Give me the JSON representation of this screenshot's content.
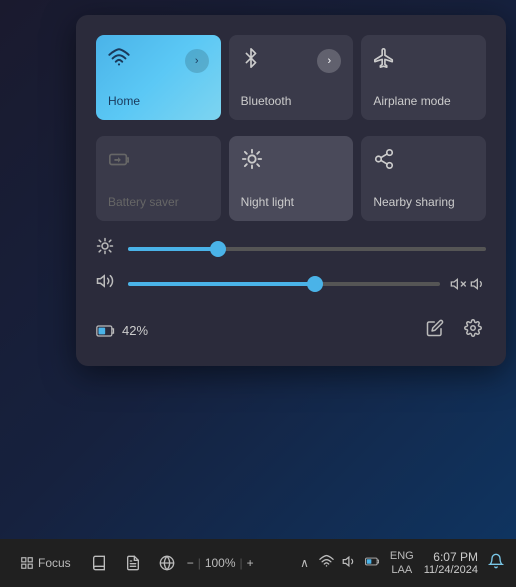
{
  "panel": {
    "tiles_row1": [
      {
        "id": "home",
        "label": "Home",
        "icon": "📶",
        "iconType": "wifi",
        "active": true,
        "hasChevron": true
      },
      {
        "id": "bluetooth",
        "label": "Bluetooth",
        "icon": "⚡",
        "iconType": "bluetooth",
        "active": false,
        "hasChevron": true
      },
      {
        "id": "airplane",
        "label": "Airplane mode",
        "icon": "✈",
        "iconType": "airplane",
        "active": false,
        "hasChevron": false
      }
    ],
    "tiles_row2": [
      {
        "id": "battery-saver",
        "label": "Battery saver",
        "icon": "🔋",
        "iconType": "battery",
        "active": false,
        "disabled": true,
        "hasChevron": false
      },
      {
        "id": "night-light",
        "label": "Night light",
        "icon": "☀",
        "iconType": "sun",
        "active": true,
        "hasChevron": false
      },
      {
        "id": "nearby-sharing",
        "label": "Nearby sharing",
        "icon": "⬆",
        "iconType": "share",
        "active": false,
        "hasChevron": false
      }
    ],
    "brightness": {
      "icon": "☀",
      "value": 25
    },
    "volume": {
      "icon": "🔊",
      "value": 60
    },
    "battery_percent": "42%",
    "battery_icon": "🔋"
  },
  "taskbar": {
    "chevron_label": "^",
    "lang_line1": "ENG",
    "lang_line2": "LAA",
    "time": "6:07 PM",
    "date": "11/24/2024",
    "focus_label": "Focus",
    "zoom_label": "100%",
    "zoom_minus": "−",
    "zoom_plus": "+"
  },
  "icons": {
    "wifi": "📶",
    "bluetooth": "⚡",
    "volume": "🔊",
    "battery": "🔋",
    "share": "⬆",
    "edit": "✏",
    "settings": "⚙",
    "bell": "🔔",
    "chevron_right": "›",
    "chevron_up": "∧",
    "airplane": "✈",
    "sun": "☀",
    "moon": "🌙"
  }
}
